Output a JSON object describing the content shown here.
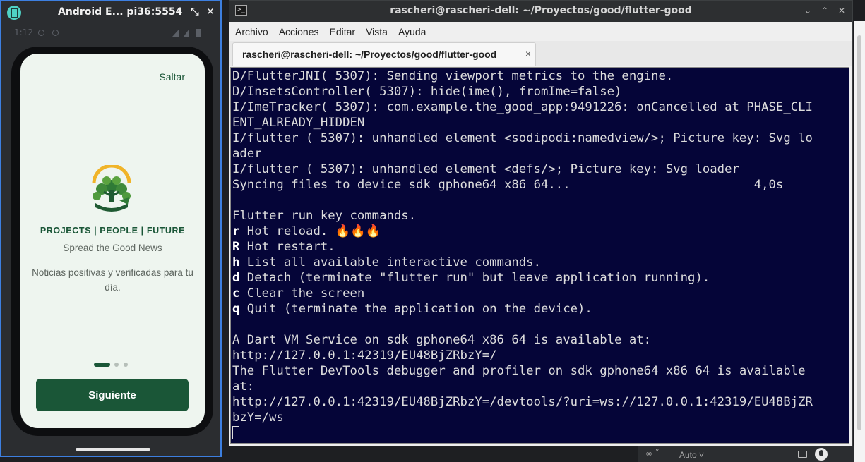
{
  "emulator": {
    "title": "Android E...   pi36:5554",
    "controls": {
      "minimize": "–",
      "shrink": "⤡",
      "close": "✕"
    },
    "status_time": "1:12",
    "app": {
      "skip_label": "Saltar",
      "tagline": "PROJECTS | PEOPLE | FUTURE",
      "subtitle": "Spread the Good News",
      "description": "Noticias positivas y verificadas para tu día.",
      "pager": {
        "total": 3,
        "active_index": 0
      },
      "next_label": "Siguiente",
      "colors": {
        "primary": "#1a5637",
        "background": "#eef5ef",
        "sun": "#f0b429",
        "leaf": "#3f8a3a"
      }
    }
  },
  "terminal": {
    "title": "rascheri@rascheri-dell: ~/Proyectos/good/flutter-good",
    "menu": [
      "Archivo",
      "Acciones",
      "Editar",
      "Vista",
      "Ayuda"
    ],
    "tab_label": "rascheri@rascheri-dell: ~/Proyectos/good/flutter-good",
    "tab_close": "×",
    "lines": [
      "D/FlutterJNI( 5307): Sending viewport metrics to the engine.",
      "D/InsetsController( 5307): hide(ime(), fromIme=false)",
      "I/ImeTracker( 5307): com.example.the_good_app:9491226: onCancelled at PHASE_CLI",
      "ENT_ALREADY_HIDDEN",
      "I/flutter ( 5307): unhandled element <sodipodi:namedview/>; Picture key: Svg lo",
      "ader",
      "I/flutter ( 5307): unhandled element <defs/>; Picture key: Svg loader",
      "Syncing files to device sdk gphone64 x86 64...                         4,0s",
      "",
      "Flutter run key commands."
    ],
    "commands": [
      {
        "key": "r",
        "text": " Hot reload. 🔥🔥🔥"
      },
      {
        "key": "R",
        "text": " Hot restart."
      },
      {
        "key": "h",
        "text": " List all available interactive commands."
      },
      {
        "key": "d",
        "text": " Detach (terminate \"flutter run\" but leave application running)."
      },
      {
        "key": "c",
        "text": " Clear the screen"
      },
      {
        "key": "q",
        "text": " Quit (terminate the application on the device)."
      }
    ],
    "lines_after": [
      "",
      "A Dart VM Service on sdk gphone64 x86 64 is available at:",
      "http://127.0.0.1:42319/EU48BjZRbzY=/",
      "The Flutter DevTools debugger and profiler on sdk gphone64 x86 64 is available",
      "at:",
      "http://127.0.0.1:42319/EU48BjZRbzY=/devtools/?uri=ws://127.0.0.1:42319/EU48BjZR",
      "bzY=/ws"
    ],
    "colors": {
      "console_bg": "#050538",
      "console_fg": "#dcdcdc"
    }
  },
  "panel": {
    "loop_label": "∞ ˅",
    "quality_label": "Auto ˅"
  }
}
